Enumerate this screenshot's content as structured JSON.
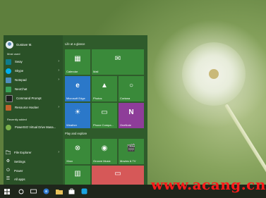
{
  "user": {
    "name": "Gustave M."
  },
  "left_pane": {
    "most_used_label": "Most used",
    "most_used": [
      {
        "label": "Sway",
        "icon": "sway-icon",
        "color": "#0f7b8a"
      },
      {
        "label": "Skype",
        "icon": "skype-icon",
        "color": "#00aff0"
      },
      {
        "label": "Notepad",
        "icon": "notepad-icon",
        "color": "#4f8fbf"
      },
      {
        "label": "NeoChat",
        "icon": "neochat-icon",
        "color": "#3aa35a"
      },
      {
        "label": "Command Prompt",
        "icon": "command-prompt-icon",
        "color": "#1e1e1e"
      },
      {
        "label": "Resource Hacker",
        "icon": "resource-hacker-icon",
        "color": "#c4632d"
      }
    ],
    "recently_added_label": "Recently added",
    "recently_added": [
      {
        "label": "PowerISO Virtual Drive Mana...",
        "icon": "poweriso-icon",
        "color": "#7bb04a"
      }
    ],
    "system": [
      {
        "label": "File Explorer",
        "icon": "folder-icon"
      },
      {
        "label": "Settings",
        "icon": "gear-icon"
      },
      {
        "label": "Power",
        "icon": "power-icon"
      },
      {
        "label": "All apps",
        "icon": "all-apps-icon"
      }
    ]
  },
  "tiles": {
    "group1_label": "Life at a glance",
    "group2_label": "Play and explore",
    "calendar": "Calendar",
    "mail": "Mail",
    "edge": "Microsoft Edge",
    "photos": "Photos",
    "cortana": "Cortana",
    "weather": "Weather",
    "phone": "Phone Compa...",
    "onenote": "OneNote",
    "xbox": "Xbox",
    "groove": "Groove Music",
    "movies": "Movies & TV"
  },
  "colors": {
    "tile_green": "#3a8a3a",
    "tile_blue": "#2b78c9",
    "tile_purple": "#8e3d99",
    "tile_red": "#d65858",
    "menu_bg": "#2f5b2b"
  },
  "taskbar": {
    "items": [
      "windows-start-icon",
      "search-icon",
      "task-view-icon",
      "browser-icon",
      "file-explorer-icon",
      "store-icon",
      "skype-icon"
    ]
  },
  "watermark": "www.acang.cn"
}
